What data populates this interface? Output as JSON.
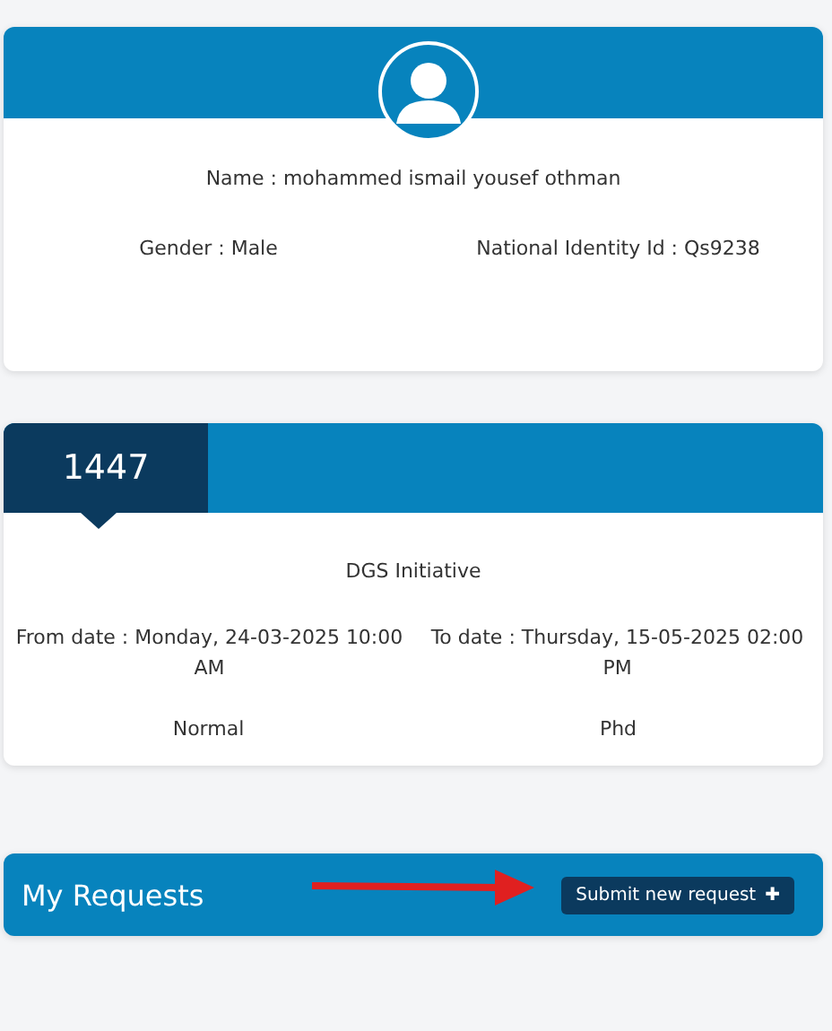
{
  "profile": {
    "name": "Name : mohammed ismail yousef othman",
    "gender": "Gender : Male",
    "national_id": "National Identity Id : Qs9238"
  },
  "initiative": {
    "year": "1447",
    "title": "DGS Initiative",
    "from_date": "From date : Monday, 24-03-2025 10:00 AM",
    "to_date": "To date : Thursday, 15-05-2025 02:00 PM",
    "type": "Normal",
    "degree": "Phd"
  },
  "requests": {
    "title": "My Requests",
    "button": "Submit new request",
    "button_icon": "✚"
  }
}
